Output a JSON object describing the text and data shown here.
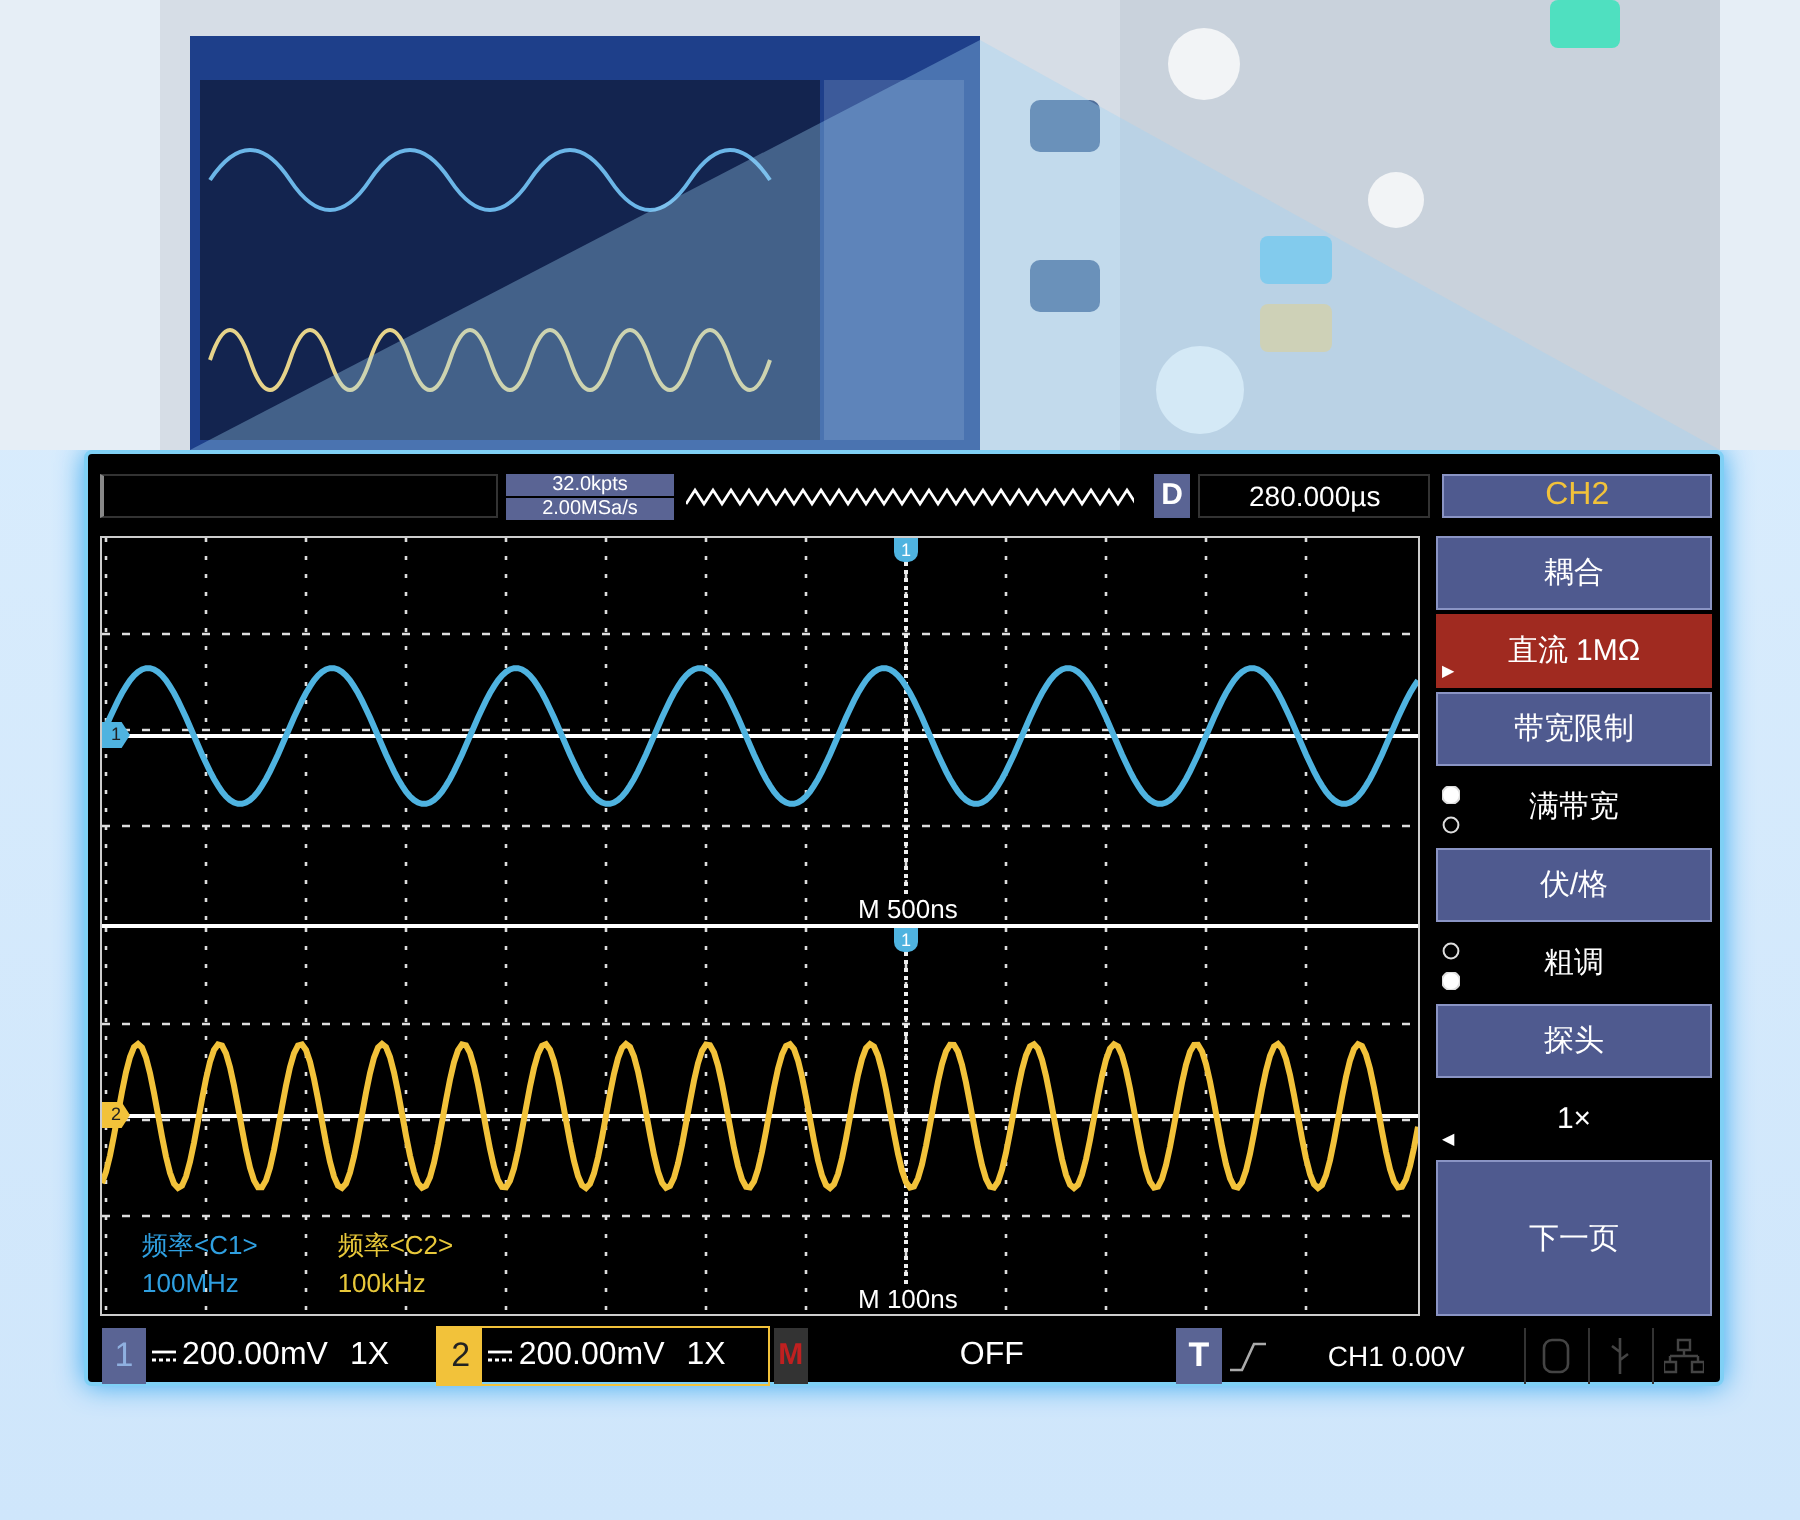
{
  "header": {
    "memory_depth": "32.0kpts",
    "sample_rate": "2.00MSa/s",
    "delay_label": "D",
    "delay": "280.000µs"
  },
  "menu": {
    "title": "CH2",
    "items": [
      {
        "kind": "title",
        "label": "耦合"
      },
      {
        "kind": "value",
        "label": "直流 1MΩ",
        "highlighted": true,
        "arrow": "▶"
      },
      {
        "kind": "title",
        "label": "带宽限制"
      },
      {
        "kind": "radio",
        "label": "满带宽",
        "options": [
          {
            "selected": true
          },
          {
            "selected": false
          }
        ]
      },
      {
        "kind": "title",
        "label": "伏/格"
      },
      {
        "kind": "radio",
        "label": "粗调",
        "options": [
          {
            "selected": false
          },
          {
            "selected": true
          }
        ]
      },
      {
        "kind": "title",
        "label": "探头"
      },
      {
        "kind": "value",
        "label": "1×",
        "highlighted": false,
        "arrow": "◀"
      },
      {
        "kind": "button",
        "label": "下一页"
      }
    ]
  },
  "panes": [
    {
      "timebase": "M 500ns",
      "trigger_marker": "1",
      "channel_marker": "1",
      "color": "#4fb3e0"
    },
    {
      "timebase": "M 100ns",
      "trigger_marker": "1",
      "channel_marker": "2",
      "color": "#f2c23a",
      "measurements": [
        {
          "name": "频率<C1>",
          "value": "100MHz",
          "color": "#2f9fe0"
        },
        {
          "name": "频率<C2>",
          "value": "100kHz",
          "color": "#e8c83a"
        }
      ]
    }
  ],
  "status_bar": {
    "channels": [
      {
        "number": "1",
        "scale": "200.00mV",
        "probe": "1X",
        "color": "#5a6494",
        "active": false
      },
      {
        "number": "2",
        "scale": "200.00mV",
        "probe": "1X",
        "color": "#f2c23a",
        "active": true
      }
    ],
    "math_label": "M",
    "math_state": "OFF",
    "trigger_label": "T",
    "trigger_source": "CH1 0.00V"
  }
}
